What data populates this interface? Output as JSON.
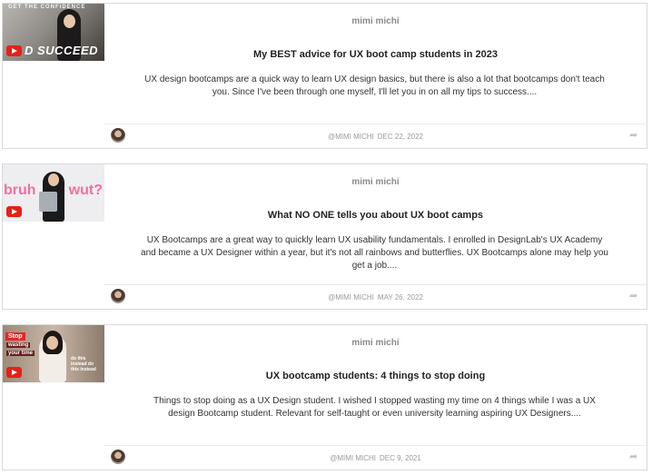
{
  "cards": [
    {
      "thumbnail": {
        "top_text": "GET THE CONFIDENCE",
        "big_text": "D SUCCEED"
      },
      "author": "mimi michi",
      "title": "My BEST advice for UX boot camp students in 2023",
      "description": "UX design bootcamps are a quick way to learn UX design basics, but there is also a lot that bootcamps don't teach you. Since I've been through one myself, I'll let you in on all my tips to success....",
      "handle": "@MIMI MICHI",
      "date": "DEC 22, 2022"
    },
    {
      "thumbnail": {
        "left_text": "bruh",
        "right_text": "wut?"
      },
      "author": "mimi michi",
      "title": "What NO ONE tells you about UX boot camps",
      "description": "UX Bootcamps are a great way to quickly learn UX usability fundamentals. I enrolled in DesignLab's UX Academy and became a UX Designer within a year, but it's not all rainbows and butterflies. UX Bootcamps alone may help you get a job....",
      "handle": "@MIMI MICHI",
      "date": "MAY 26, 2022"
    },
    {
      "thumbnail": {
        "stop_text": "Stop",
        "line1": "wasting",
        "line2": "your time",
        "side_text": "do this instead do this instead"
      },
      "author": "mimi michi",
      "title": "UX bootcamp students: 4 things to stop doing",
      "description": "Things to stop doing as a UX Design student. I wished I stopped wasting my time on 4 things while I was a UX design Bootcamp student. Relevant for self-taught or even university learning aspiring UX Designers....",
      "handle": "@MIMI MICHI",
      "date": "DEC 9, 2021"
    }
  ],
  "icons": {
    "play": "youtube-play-icon",
    "share": "share-icon",
    "avatar": "author-avatar"
  },
  "colors": {
    "youtube_red": "#e62117",
    "pink_text": "#f26fa0",
    "border": "#d9d9d9"
  }
}
